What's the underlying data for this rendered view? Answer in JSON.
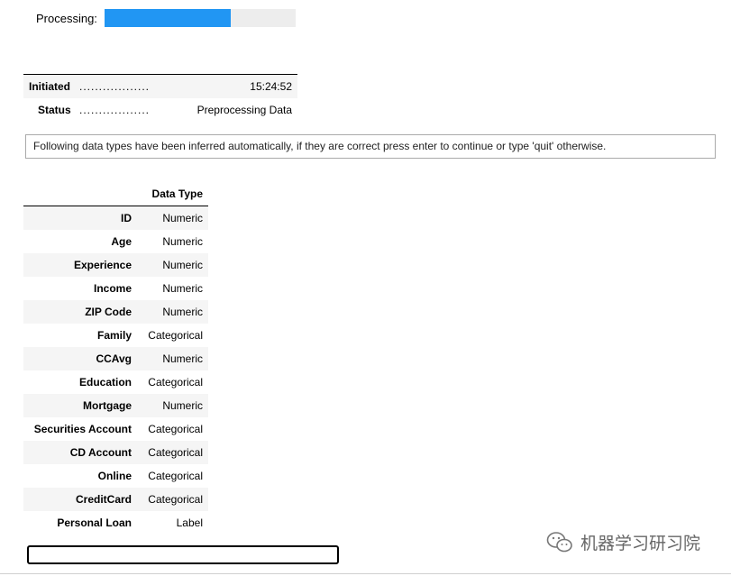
{
  "progress": {
    "label": "Processing:",
    "fraction": 0.66,
    "fill_color": "#2196f3",
    "track_color": "#ededed"
  },
  "status_table": [
    {
      "key": "Initiated",
      "dots": "..................",
      "value": "15:24:52"
    },
    {
      "key": "Status",
      "dots": "..................",
      "value": "Preprocessing Data"
    }
  ],
  "info_message": "Following data types have been inferred automatically, if they are correct press enter to continue or type 'quit' otherwise.",
  "dtype_table": {
    "header": "Data Type",
    "rows": [
      {
        "name": "ID",
        "type": "Numeric"
      },
      {
        "name": "Age",
        "type": "Numeric"
      },
      {
        "name": "Experience",
        "type": "Numeric"
      },
      {
        "name": "Income",
        "type": "Numeric"
      },
      {
        "name": "ZIP Code",
        "type": "Numeric"
      },
      {
        "name": "Family",
        "type": "Categorical"
      },
      {
        "name": "CCAvg",
        "type": "Numeric"
      },
      {
        "name": "Education",
        "type": "Categorical"
      },
      {
        "name": "Mortgage",
        "type": "Numeric"
      },
      {
        "name": "Securities Account",
        "type": "Categorical"
      },
      {
        "name": "CD Account",
        "type": "Categorical"
      },
      {
        "name": "Online",
        "type": "Categorical"
      },
      {
        "name": "CreditCard",
        "type": "Categorical"
      },
      {
        "name": "Personal Loan",
        "type": "Label"
      }
    ]
  },
  "input": {
    "value": ""
  },
  "watermark": {
    "text": "机器学习研习院",
    "icon": "wechat-icon"
  }
}
